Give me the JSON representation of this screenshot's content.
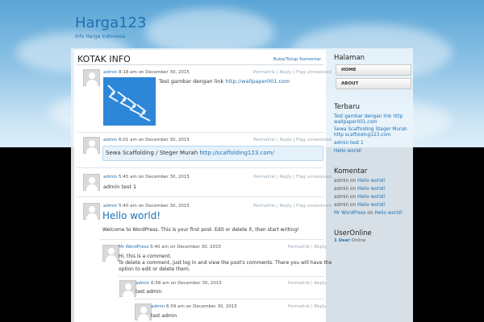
{
  "site": {
    "title": "Harga123",
    "description": "Info Harga Indonesia"
  },
  "main": {
    "title": "KOTAK INFO",
    "toggle_label": "Buka/Tutup Komentar",
    "actions": {
      "permalink": "Permalink",
      "reply": "Reply",
      "flag": "Flag unresolved"
    },
    "comments": [
      {
        "author": "admin",
        "time": "8:18 am",
        "on": "on",
        "date": "December 30, 2015",
        "text_prefix": "Test gambar dengan link ",
        "link": "http://wallpaper001.com"
      },
      {
        "author": "admin",
        "time": "6:01 am",
        "on": "on",
        "date": "December 30, 2015",
        "text_prefix": "Sewa Scaffolding / Steger Murah ",
        "link": "http://scaffolding123.com/"
      },
      {
        "author": "admin",
        "time": "5:45 am",
        "on": "on",
        "date": "December 30, 2015",
        "text": "admin test 1"
      },
      {
        "author": "admin",
        "time": "5:40 am",
        "on": "on",
        "date": "December 30, 2015",
        "heading": "Hello world!",
        "text": "Welcome to WordPress. This is your first post. Edit or delete it, then start writing!"
      }
    ],
    "replies": [
      {
        "author": "Mr WordPress",
        "time": "5:40 am",
        "on": "on",
        "date": "December 30, 2015",
        "line1": "Hi, this is a comment.",
        "line2": "To delete a comment, just log in and view the post's comments. There you will have the",
        "line3": "option to edit or delete them."
      },
      {
        "author": "admin",
        "time": "6:58 am",
        "on": "on",
        "date": "December 30, 2015",
        "text": "test admin"
      },
      {
        "author": "admin",
        "time": "6:59 am",
        "on": "on",
        "date": "December 30, 2015",
        "text": "test admin"
      }
    ]
  },
  "sidebar": {
    "halaman": {
      "title": "Halaman",
      "items": [
        "HOME",
        "ABOUT"
      ]
    },
    "terbaru": {
      "title": "Terbaru",
      "items": [
        "Test gambar dengan link http wallpaper001.com",
        "Sewa Scaffolding Steger Murah http scaffolding123.com",
        "admin test 1",
        "Hello world!"
      ]
    },
    "komentar": {
      "title": "Komentar",
      "on": "on",
      "items": [
        {
          "author": "admin",
          "post": "Hello world!"
        },
        {
          "author": "admin",
          "post": "Hello world!"
        },
        {
          "author": "admin",
          "post": "Hello world!"
        },
        {
          "author": "admin",
          "post": "Hello world!"
        },
        {
          "author": "Mr WordPress",
          "post": "Hello world!"
        }
      ]
    },
    "useronline": {
      "title": "UserOnline",
      "count": "1",
      "count_label": "User",
      "status": "Online"
    }
  },
  "colors": {
    "link": "#1f6fb3",
    "sky": "#8ec3e6",
    "background": "#000000"
  }
}
